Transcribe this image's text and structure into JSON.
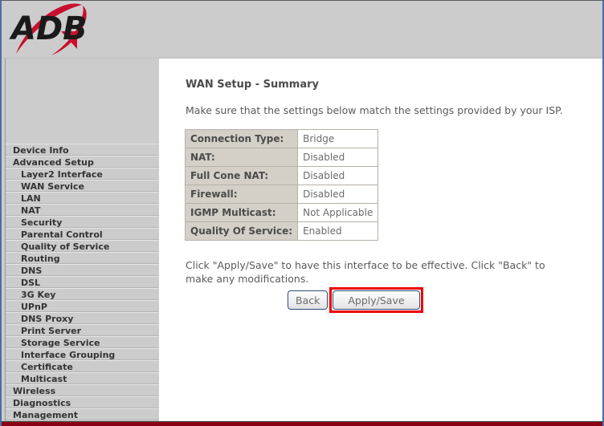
{
  "brand": {
    "logo_text": "ADB",
    "logo_colors": {
      "text": "#1a1a1a",
      "swoosh": "#c8102e",
      "triangle": "#c8102e"
    }
  },
  "sidebar": {
    "items": [
      {
        "label": "Device Info",
        "level": 1
      },
      {
        "label": "Advanced Setup",
        "level": 1
      },
      {
        "label": "Layer2 Interface",
        "level": 2
      },
      {
        "label": "WAN Service",
        "level": 2
      },
      {
        "label": "LAN",
        "level": 2
      },
      {
        "label": "NAT",
        "level": 2
      },
      {
        "label": "Security",
        "level": 2
      },
      {
        "label": "Parental Control",
        "level": 2
      },
      {
        "label": "Quality of Service",
        "level": 2
      },
      {
        "label": "Routing",
        "level": 2
      },
      {
        "label": "DNS",
        "level": 2
      },
      {
        "label": "DSL",
        "level": 2
      },
      {
        "label": "3G Key",
        "level": 2
      },
      {
        "label": "UPnP",
        "level": 2
      },
      {
        "label": "DNS Proxy",
        "level": 2
      },
      {
        "label": "Print Server",
        "level": 2
      },
      {
        "label": "Storage Service",
        "level": 2
      },
      {
        "label": "Interface Grouping",
        "level": 2
      },
      {
        "label": "Certificate",
        "level": 2
      },
      {
        "label": "Multicast",
        "level": 2
      },
      {
        "label": "Wireless",
        "level": 1
      },
      {
        "label": "Diagnostics",
        "level": 1
      },
      {
        "label": "Management",
        "level": 1
      }
    ]
  },
  "main": {
    "title": "WAN Setup - Summary",
    "intro": "Make sure that the settings below match the settings provided by your ISP.",
    "summary_rows": [
      {
        "label": "Connection Type:",
        "value": "Bridge"
      },
      {
        "label": "NAT:",
        "value": "Disabled"
      },
      {
        "label": "Full Cone NAT:",
        "value": "Disabled"
      },
      {
        "label": "Firewall:",
        "value": "Disabled"
      },
      {
        "label": "IGMP Multicast:",
        "value": "Not Applicable"
      },
      {
        "label": "Quality Of Service:",
        "value": "Enabled"
      }
    ],
    "note": "Click \"Apply/Save\" to have this interface to be effective. Click \"Back\" to make any modifications.",
    "buttons": {
      "back": "Back",
      "apply_save": "Apply/Save"
    },
    "highlight_color": "#ee0000"
  }
}
